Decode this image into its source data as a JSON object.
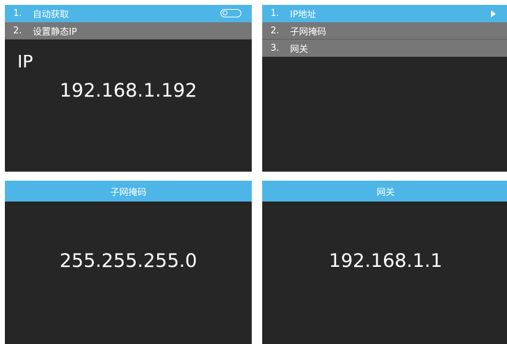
{
  "panel_tl": {
    "rows": [
      {
        "num": "1.",
        "label": "自动获取",
        "toggle": "off"
      },
      {
        "num": "2.",
        "label": "设置静态IP"
      }
    ],
    "heading": "IP",
    "value": "192.168.1.192"
  },
  "panel_tr": {
    "rows": [
      {
        "num": "1.",
        "label": "IP地址"
      },
      {
        "num": "2.",
        "label": "子网掩码"
      },
      {
        "num": "3.",
        "label": "网关"
      }
    ]
  },
  "panel_bl": {
    "title": "子网掩码",
    "value": "255.255.255.0"
  },
  "panel_br": {
    "title": "网关",
    "value": "192.168.1.1"
  },
  "colors": {
    "accent": "#4db6e6",
    "panel_bg": "#262626",
    "row_gray": "#777777"
  },
  "icons": {
    "toggle": "toggle-switch-icon",
    "arrow": "play-arrow-icon"
  }
}
